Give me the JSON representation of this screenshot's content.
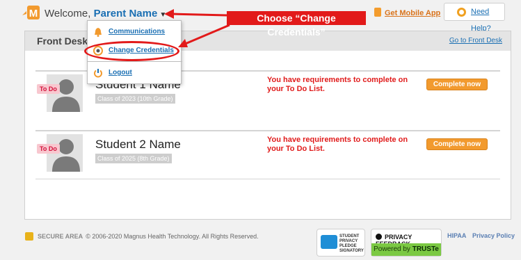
{
  "header": {
    "welcome_label": "Welcome,",
    "parent_name": "Parent Name",
    "callout_text": "Choose “Change Credentials”",
    "mobile_app_label": "Get Mobile App",
    "help_label": "Need Help?"
  },
  "dropdown": {
    "items": [
      {
        "label": "Communications",
        "icon": "bell-icon"
      },
      {
        "label": "Change Credentials",
        "icon": "credentials-icon"
      },
      {
        "label": "Logout",
        "icon": "power-icon"
      }
    ]
  },
  "panel": {
    "title": "Front Desk",
    "go_link": "Go to Front Desk"
  },
  "students": [
    {
      "name": "Student 1 Name",
      "class": "Class of 2023 (10th Grade)",
      "badge": "To Do",
      "requirement": "You have requirements to complete on your To Do List.",
      "button": "Complete now"
    },
    {
      "name": "Student 2 Name",
      "class": "Class of 2025 (8th Grade)",
      "badge": "To Do",
      "requirement": "You have requirements to complete on your To Do List.",
      "button": "Complete now"
    }
  ],
  "footer": {
    "secure": "SECURE AREA",
    "copyright": "© 2006-2020 Magnus Health Technology. All Rights Reserved.",
    "pledge": "STUDENT\nPRIVACY\nPLEDGE\nSIGNATORY",
    "privacy_feedback": "PRIVACY FEEDBACK",
    "powered_by": "Powered by",
    "truste": "TRUSTe",
    "hipaa": "HIPAA",
    "privacy_policy": "Privacy Policy"
  },
  "colors": {
    "accent_blue": "#1a6fb3",
    "alert_red": "#e21a1a",
    "button_orange": "#f29a2e"
  }
}
